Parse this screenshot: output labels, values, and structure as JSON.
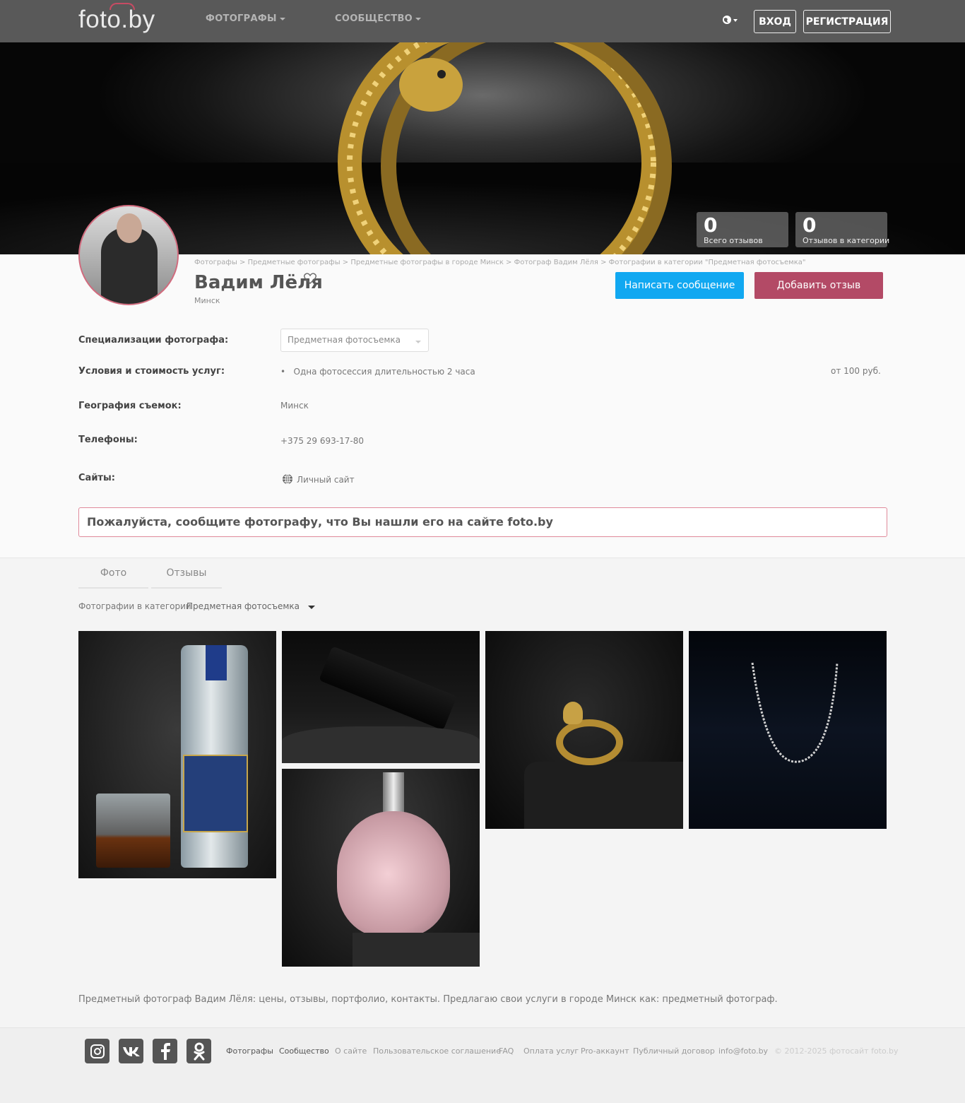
{
  "header": {
    "logo": "foto.by",
    "nav": [
      {
        "label": "ФОТОГРАФЫ"
      },
      {
        "label": "СООБЩЕСТВО"
      }
    ],
    "login_label": "ВХОД",
    "register_label": "РЕГИСТРАЦИЯ",
    "language_icon": "globe-icon"
  },
  "stats": [
    {
      "value": "0",
      "label": "Всего отзывов"
    },
    {
      "value": "0",
      "label": "Отзывов в категории"
    }
  ],
  "breadcrumb": "Фотографы > Предметные фотографы > Предметные фотографы в городе Минск > Фотограф Вадим Лёля > Фотографии в категории \"Предметная фотосъемка\"",
  "profile": {
    "name": "Вадим Лёля",
    "city": "Минск",
    "message_button": "Написать сообщение",
    "review_button": "Добавить отзыв"
  },
  "details": {
    "specializations_label": "Специализации фотографа:",
    "specialization_selected": "Предметная фотосъемка",
    "services_label": "Условия и стоимость услуг:",
    "service_item": "Одна фотосессия длительностью 2 часа",
    "service_price": "от 100 руб.",
    "geography_label": "География съемок:",
    "geography_value": "Минск",
    "phones_label": "Телефоны:",
    "phone_value": "+375 29 693-17-80",
    "sites_label": "Сайты:",
    "site_value": "Личный сайт"
  },
  "notice": "Пожалуйста, сообщите фотографу, что Вы нашли его на сайте foto.by",
  "tabs": [
    {
      "label": "Фото"
    },
    {
      "label": "Отзывы"
    }
  ],
  "filter": {
    "label": "Фотографии в категории",
    "value": "Предметная фотосъемка"
  },
  "seo_text": "Предметный фотограф Вадим Лёля: цены, отзывы, портфолио, контакты. Предлагаю свои услуги в городе Минск как: предметный фотограф.",
  "footer": {
    "social": [
      "instagram-icon",
      "vk-icon",
      "facebook-icon",
      "odnoklassniki-icon"
    ],
    "links": [
      "Фотографы",
      "Сообщество",
      "О сайте",
      "Пользовательское соглашение",
      "FAQ",
      "Оплата услуг",
      "Pro-аккаунт",
      "Публичный договор",
      "info@foto.by"
    ],
    "copyright": "© 2012-2025 фотосайт foto.by"
  },
  "colors": {
    "accent_blue": "#11a8f1",
    "accent_red": "#b34a66",
    "nav_bg": "#595959"
  }
}
